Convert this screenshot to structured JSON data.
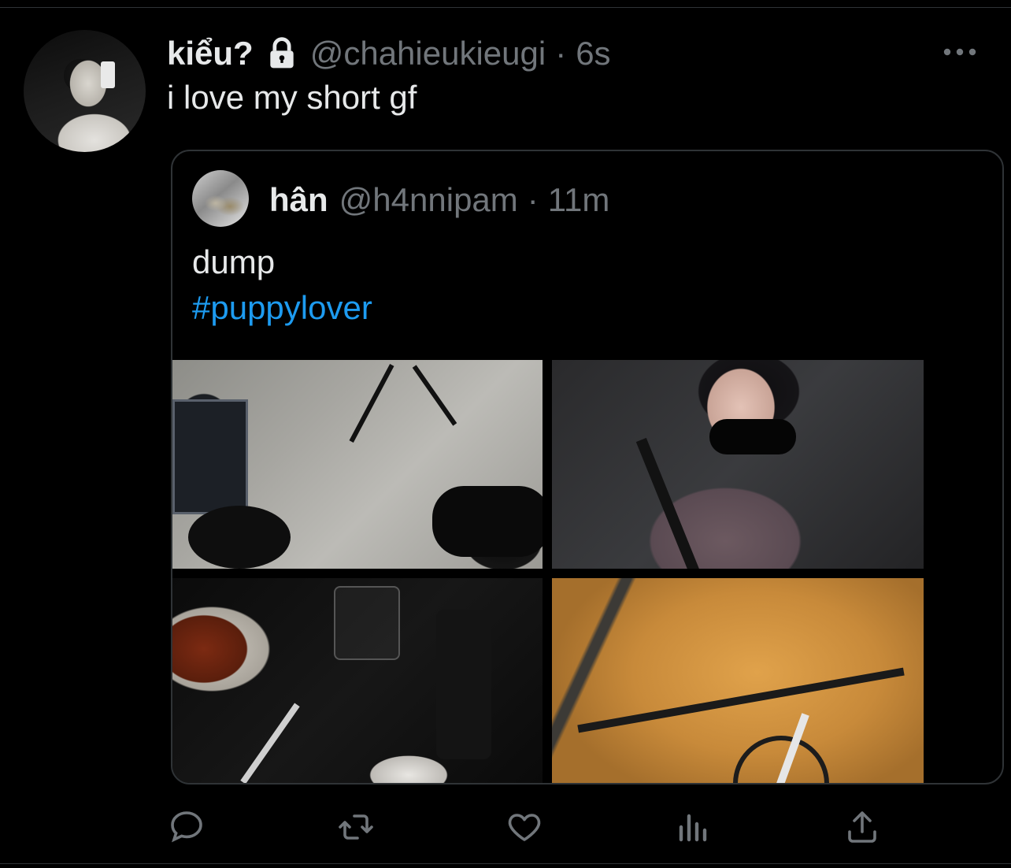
{
  "tweet": {
    "author_name": "kiểu?",
    "handle": "@chahieukieugi",
    "separator": "·",
    "time": "6s",
    "text": "i love my short gf",
    "icons": {
      "lock": "lock-icon",
      "more": "more-icon"
    }
  },
  "quote": {
    "author_name": "hân",
    "handle": "@h4nnipam",
    "separator": "·",
    "time": "11m",
    "text": "dump",
    "hashtag": "#puppylover",
    "photos": [
      "photo",
      "photo",
      "photo",
      "photo"
    ]
  },
  "actions": [
    {
      "name": "reply-icon"
    },
    {
      "name": "retweet-icon"
    },
    {
      "name": "like-icon"
    },
    {
      "name": "analytics-icon"
    },
    {
      "name": "share-icon"
    }
  ],
  "colors": {
    "background": "#000000",
    "text_primary": "#e7e9ea",
    "text_secondary": "#71767b",
    "accent": "#1d9bf0",
    "border": "#2f3336"
  }
}
